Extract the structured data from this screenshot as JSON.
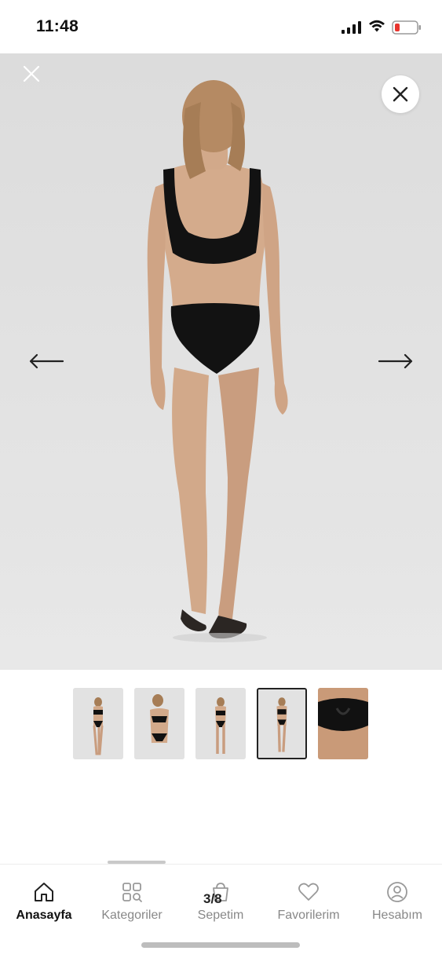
{
  "status_bar": {
    "time": "11:48",
    "battery_color": "#e8352f"
  },
  "gallery": {
    "left_arrow": "arrow-left-icon",
    "right_arrow": "arrow-right-icon",
    "close_small": "close-icon",
    "close_button": "close-icon"
  },
  "thumbnails": {
    "count": 5,
    "active_index": 3
  },
  "bottom_nav": {
    "items": [
      {
        "label": "Anasayfa",
        "icon": "home-icon"
      },
      {
        "label": "Kategoriler",
        "icon": "categories-icon"
      },
      {
        "label": "Sepetim",
        "icon": "cart-icon"
      },
      {
        "label": "Favorilerim",
        "icon": "heart-icon"
      },
      {
        "label": "Hesabım",
        "icon": "account-icon"
      }
    ],
    "active": "Anasayfa",
    "cart_badge": "3/8"
  }
}
